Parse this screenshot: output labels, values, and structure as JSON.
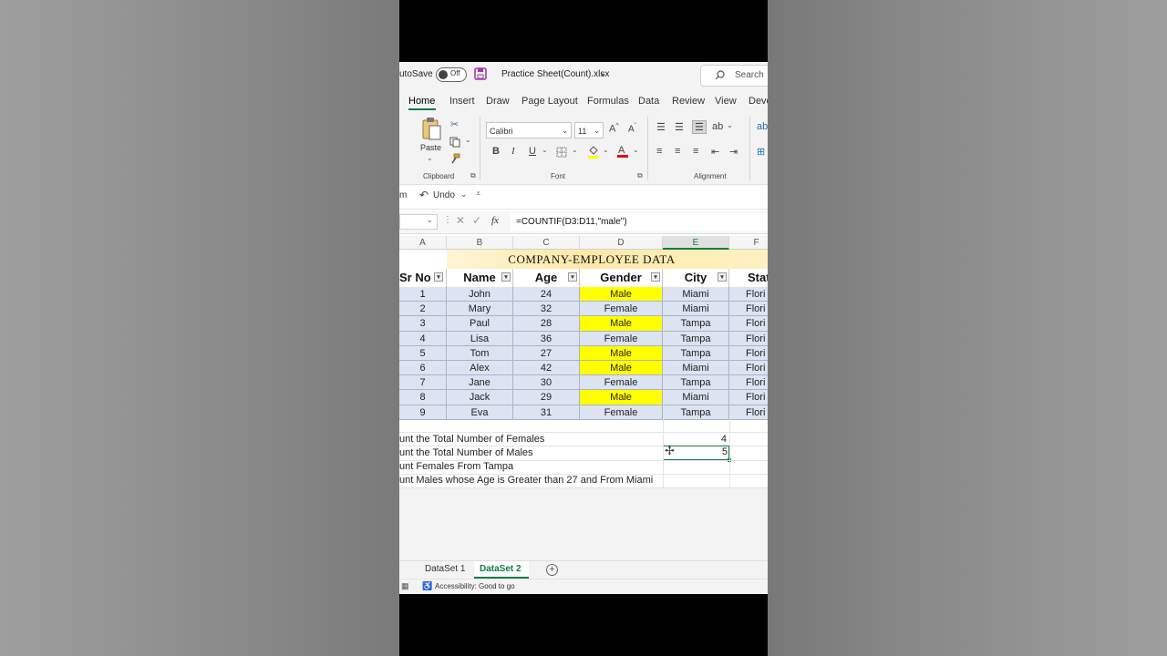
{
  "titlebar": {
    "autosave_label": "utoSave",
    "toggle_state": "Off",
    "file_name": "Practice Sheet(Count).xlsx",
    "search_label": "Search"
  },
  "ribbon_tabs": [
    "Home",
    "Insert",
    "Draw",
    "Page Layout",
    "Formulas",
    "Data",
    "Review",
    "View",
    "Deve"
  ],
  "ribbon": {
    "paste_label": "Paste",
    "clipboard_label": "Clipboard",
    "font_name": "Calibri",
    "font_size": "11",
    "font_label": "Font",
    "alignment_label": "Alignment",
    "bold": "B",
    "italic": "I",
    "underline": "U"
  },
  "qat": {
    "partial_label": "m",
    "undo_label": "Undo"
  },
  "formula_bar": {
    "fx_label": "fx",
    "formula": "=COUNTIF(D3:D11,\"male\")"
  },
  "columns": [
    "A",
    "B",
    "C",
    "D",
    "E",
    "F"
  ],
  "table": {
    "title": "COMPANY-EMPLOYEE DATA",
    "headers": [
      "Sr No",
      "Name",
      "Age",
      "Gender",
      "City",
      "Stat"
    ],
    "rows": [
      [
        "1",
        "John",
        "24",
        "Male",
        "Miami",
        "Flori"
      ],
      [
        "2",
        "Mary",
        "32",
        "Female",
        "Miami",
        "Flori"
      ],
      [
        "3",
        "Paul",
        "28",
        "Male",
        "Tampa",
        "Flori"
      ],
      [
        "4",
        "Lisa",
        "36",
        "Female",
        "Tampa",
        "Flori"
      ],
      [
        "5",
        "Tom",
        "27",
        "Male",
        "Tampa",
        "Flori"
      ],
      [
        "6",
        "Alex",
        "42",
        "Male",
        "Miami",
        "Flori"
      ],
      [
        "7",
        "Jane",
        "30",
        "Female",
        "Tampa",
        "Flori"
      ],
      [
        "8",
        "Jack",
        "29",
        "Male",
        "Miami",
        "Flori"
      ],
      [
        "9",
        "Eva",
        "31",
        "Female",
        "Tampa",
        "Flori"
      ]
    ]
  },
  "tasks": [
    {
      "text": "unt the Total Number of Females",
      "value": "4"
    },
    {
      "text": "unt the Total Number of Males",
      "value": "5"
    },
    {
      "text": "unt Females From Tampa",
      "value": ""
    },
    {
      "text": "unt Males whose Age is Greater than 27 and From Miami",
      "value": ""
    }
  ],
  "sheet_tabs": [
    "DataSet 1",
    "DataSet 2"
  ],
  "active_sheet": "DataSet 2",
  "status": {
    "accessibility": "Accessibility: Good to go"
  },
  "colors": {
    "accent": "#107c41",
    "male_highlight": "#ffff00",
    "table_fill": "#dce3f1",
    "title_fill": "#fdf0b8",
    "save_icon": "#a33aa8"
  }
}
